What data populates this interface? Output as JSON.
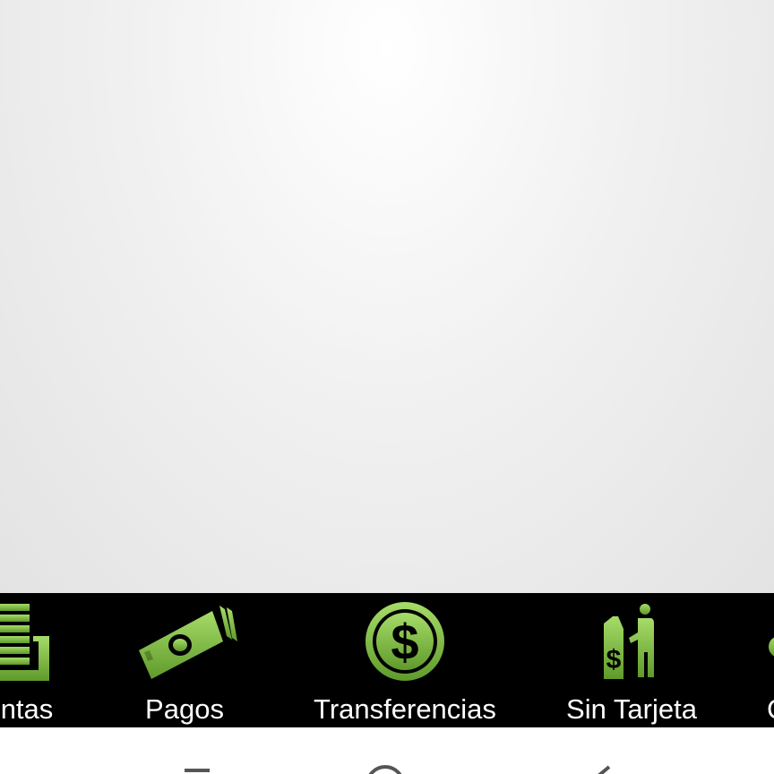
{
  "accent_color": "#7cc242",
  "bottom_nav": {
    "items": [
      {
        "label": "ntas",
        "icon": "accounts-stack-icon"
      },
      {
        "label": "Pagos",
        "icon": "banknote-icon"
      },
      {
        "label": "Transferencias",
        "icon": "dollar-circle-icon"
      },
      {
        "label": "Sin Tarjeta",
        "icon": "atm-person-icon"
      },
      {
        "label": "C",
        "icon": "more-icon"
      }
    ]
  },
  "system_nav": {
    "buttons": [
      {
        "icon": "recent-apps-icon"
      },
      {
        "icon": "home-icon"
      },
      {
        "icon": "back-icon"
      }
    ]
  }
}
